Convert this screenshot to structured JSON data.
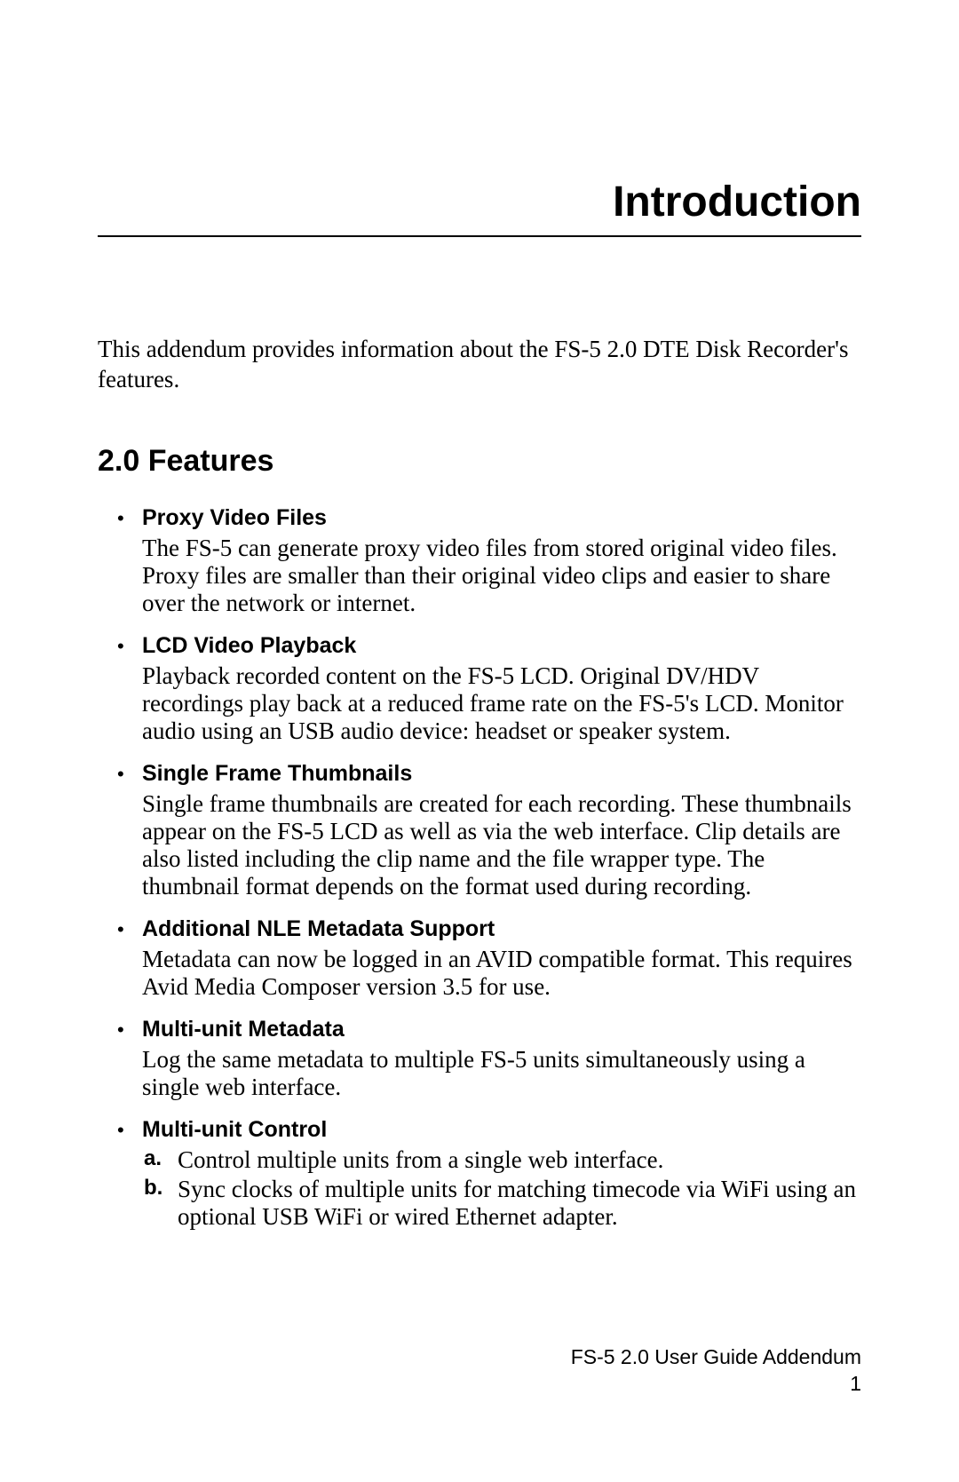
{
  "chapter_title": "Introduction",
  "intro_paragraph": "This addendum provides information about the FS-5 2.0 DTE Disk Recorder's features.",
  "section_heading": "2.0 Features",
  "features": [
    {
      "title": "Proxy Video Files",
      "body": "The FS-5 can generate proxy video files from stored original video files. Proxy files are smaller than their original video clips and easier to share over the network or internet."
    },
    {
      "title": "LCD Video Playback",
      "body": "Playback recorded content on the FS-5 LCD. Original DV/HDV recordings play back at a reduced frame rate on the FS-5's LCD. Monitor audio using an USB audio device: headset or speaker system."
    },
    {
      "title": "Single Frame Thumbnails",
      "body": "Single frame thumbnails are created for each recording. These thumbnails appear on the FS-5 LCD as well as via the web interface. Clip details are also listed including the clip name and the file wrapper type. The thumbnail format depends on the format used during recording."
    },
    {
      "title": "Additional NLE Metadata Support",
      "body": "Metadata can now be logged in an AVID compatible format. This requires Avid Media Composer version 3.5 for use."
    },
    {
      "title": "Multi-unit Metadata",
      "body": "Log the same metadata to multiple FS-5 units simultaneously using a single web interface."
    },
    {
      "title": "Multi-unit Control",
      "sublist": [
        {
          "letter": "a.",
          "text": "Control multiple units from a single web interface."
        },
        {
          "letter": "b.",
          "text": "Sync clocks of multiple units for matching timecode via WiFi using an optional USB WiFi or wired Ethernet adapter."
        }
      ]
    }
  ],
  "footer": {
    "doc_title": "FS-5 2.0 User Guide Addendum",
    "page_number": "1"
  }
}
